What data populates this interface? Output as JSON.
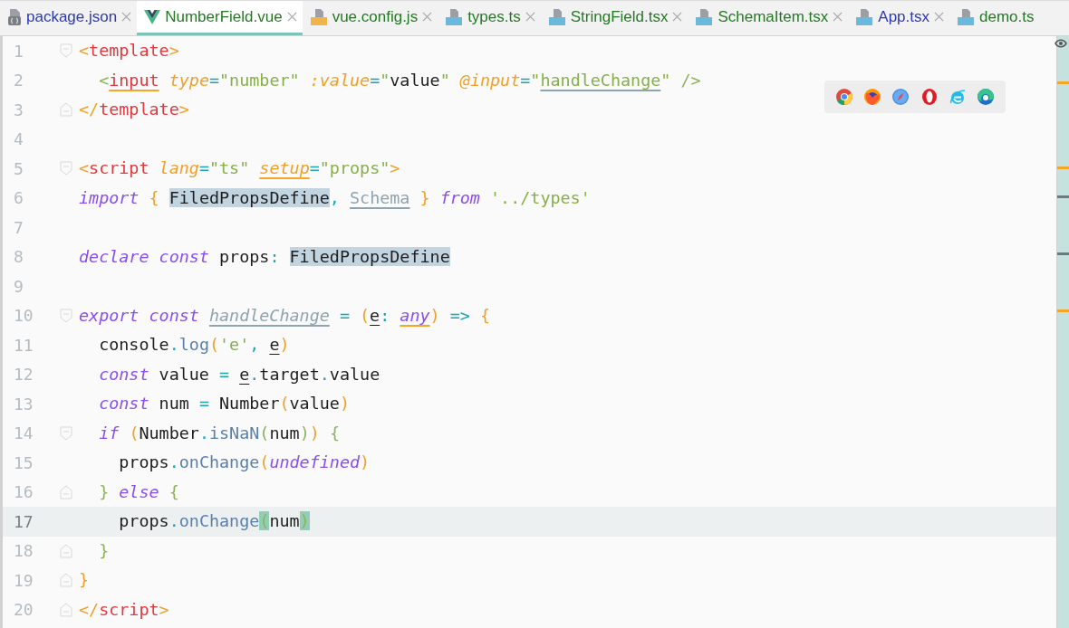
{
  "tabs": [
    {
      "label": "package.json",
      "kind": "json",
      "color": "#2b3ab0",
      "selected": false,
      "closable": true
    },
    {
      "label": "NumberField.vue",
      "kind": "vue",
      "color": "#247a24",
      "selected": true,
      "closable": true
    },
    {
      "label": "vue.config.js",
      "kind": "js",
      "color": "#247a24",
      "selected": false,
      "closable": true
    },
    {
      "label": "types.ts",
      "kind": "ts",
      "color": "#247a24",
      "selected": false,
      "closable": true
    },
    {
      "label": "StringField.tsx",
      "kind": "tsx",
      "color": "#247a24",
      "selected": false,
      "closable": true
    },
    {
      "label": "SchemaItem.tsx",
      "kind": "tsx",
      "color": "#247a24",
      "selected": false,
      "closable": true
    },
    {
      "label": "App.tsx",
      "kind": "tsx",
      "color": "#2b3ab0",
      "selected": false,
      "closable": true
    },
    {
      "label": "demo.ts",
      "kind": "ts",
      "color": "#247a24",
      "selected": false,
      "closable": false
    }
  ],
  "lines": [
    {
      "number": "1",
      "current": false,
      "kind": "fold-start",
      "tokens": [
        {
          "text": "<",
          "kind": "bracket"
        },
        {
          "text": "template",
          "kind": "tag"
        },
        {
          "text": ">",
          "kind": "bracket"
        }
      ]
    },
    {
      "number": "2",
      "current": false,
      "tokens": [
        {
          "text": "  <",
          "kind": "brace"
        },
        {
          "text": "input",
          "kind": "tag-warn"
        },
        {
          "text": " type",
          "kind": "attr"
        },
        {
          "text": "=",
          "kind": "op"
        },
        {
          "text": "\"number\"",
          "kind": "string"
        },
        {
          "text": " :value",
          "kind": "attr"
        },
        {
          "text": "=",
          "kind": "op"
        },
        {
          "text": "\"",
          "kind": "string"
        },
        {
          "text": "value",
          "kind": "plain"
        },
        {
          "text": "\"",
          "kind": "string"
        },
        {
          "text": " @input",
          "kind": "attr"
        },
        {
          "text": "=",
          "kind": "op"
        },
        {
          "text": "\"",
          "kind": "string"
        },
        {
          "text": "handleChange",
          "kind": "string-unused"
        },
        {
          "text": "\"",
          "kind": "string"
        },
        {
          "text": " />",
          "kind": "brace"
        }
      ]
    },
    {
      "number": "3",
      "current": false,
      "kind": "fold-end",
      "tokens": [
        {
          "text": "</",
          "kind": "bracket"
        },
        {
          "text": "template",
          "kind": "tag"
        },
        {
          "text": ">",
          "kind": "bracket"
        }
      ]
    },
    {
      "number": "4",
      "current": false
    },
    {
      "number": "5",
      "current": false,
      "kind": "fold-start",
      "tokens": [
        {
          "text": "<",
          "kind": "bracket"
        },
        {
          "text": "script",
          "kind": "tag"
        },
        {
          "text": " lang",
          "kind": "attr"
        },
        {
          "text": "=",
          "kind": "op"
        },
        {
          "text": "\"ts\" ",
          "kind": "string"
        },
        {
          "text": "setup",
          "kind": "attr-warn"
        },
        {
          "text": "=",
          "kind": "op"
        },
        {
          "text": "\"props\"",
          "kind": "string"
        },
        {
          "text": ">",
          "kind": "bracket"
        }
      ]
    },
    {
      "number": "6",
      "current": false,
      "tokens": [
        {
          "text": "import ",
          "kind": "keyword"
        },
        {
          "text": "{ ",
          "kind": "bracket"
        },
        {
          "text": "FiledPropsDefine",
          "kind": "highlight"
        },
        {
          "text": ", ",
          "kind": "op"
        },
        {
          "text": "Schema",
          "kind": "unused"
        },
        {
          "text": " } ",
          "kind": "bracket"
        },
        {
          "text": "from ",
          "kind": "keyword"
        },
        {
          "text": "'../types'",
          "kind": "string"
        }
      ]
    },
    {
      "number": "7",
      "current": false
    },
    {
      "number": "8",
      "current": false,
      "tokens": [
        {
          "text": "declare const ",
          "kind": "keyword"
        },
        {
          "text": "props",
          "kind": "plain"
        },
        {
          "text": ": ",
          "kind": "op"
        },
        {
          "text": "FiledPropsDefine",
          "kind": "highlight"
        }
      ]
    },
    {
      "number": "9",
      "current": false
    },
    {
      "number": "10",
      "current": false,
      "kind": "fold-start",
      "tokens": [
        {
          "text": "export const ",
          "kind": "keyword"
        },
        {
          "text": "handleChange",
          "kind": "unused-italic"
        },
        {
          "text": " = ",
          "kind": "op"
        },
        {
          "text": "(",
          "kind": "bracket"
        },
        {
          "text": "e",
          "kind": "param"
        },
        {
          "text": ": ",
          "kind": "op"
        },
        {
          "text": "any",
          "kind": "type-warn"
        },
        {
          "text": ")",
          "kind": "bracket"
        },
        {
          "text": " => ",
          "kind": "op"
        },
        {
          "text": "{",
          "kind": "bracket"
        }
      ]
    },
    {
      "number": "11",
      "current": false,
      "tokens": [
        {
          "text": "  console",
          "kind": "plain"
        },
        {
          "text": ".",
          "kind": "op"
        },
        {
          "text": "log",
          "kind": "method"
        },
        {
          "text": "(",
          "kind": "bracket"
        },
        {
          "text": "'e'",
          "kind": "string"
        },
        {
          "text": ", ",
          "kind": "op"
        },
        {
          "text": "e",
          "kind": "param"
        },
        {
          "text": ")",
          "kind": "bracket"
        }
      ]
    },
    {
      "number": "12",
      "current": false,
      "tokens": [
        {
          "text": "  const ",
          "kind": "keyword"
        },
        {
          "text": "value ",
          "kind": "plain"
        },
        {
          "text": "= ",
          "kind": "op"
        },
        {
          "text": "e",
          "kind": "param"
        },
        {
          "text": ".",
          "kind": "op"
        },
        {
          "text": "target",
          "kind": "plain"
        },
        {
          "text": ".",
          "kind": "op"
        },
        {
          "text": "value",
          "kind": "plain"
        }
      ]
    },
    {
      "number": "13",
      "current": false,
      "tokens": [
        {
          "text": "  const ",
          "kind": "keyword"
        },
        {
          "text": "num ",
          "kind": "plain"
        },
        {
          "text": "= ",
          "kind": "op"
        },
        {
          "text": "Number",
          "kind": "plain"
        },
        {
          "text": "(",
          "kind": "bracket"
        },
        {
          "text": "value",
          "kind": "plain"
        },
        {
          "text": ")",
          "kind": "bracket"
        }
      ]
    },
    {
      "number": "14",
      "current": false,
      "kind": "fold-start",
      "tokens": [
        {
          "text": "  if ",
          "kind": "keyword"
        },
        {
          "text": "(",
          "kind": "bracket"
        },
        {
          "text": "Number",
          "kind": "plain"
        },
        {
          "text": ".",
          "kind": "op"
        },
        {
          "text": "isNaN",
          "kind": "method"
        },
        {
          "text": "(",
          "kind": "brace"
        },
        {
          "text": "num",
          "kind": "plain"
        },
        {
          "text": ")",
          "kind": "brace"
        },
        {
          "text": ") ",
          "kind": "bracket"
        },
        {
          "text": "{",
          "kind": "brace"
        }
      ]
    },
    {
      "number": "15",
      "current": false,
      "tokens": [
        {
          "text": "    props",
          "kind": "plain"
        },
        {
          "text": ".",
          "kind": "op"
        },
        {
          "text": "onChange",
          "kind": "method"
        },
        {
          "text": "(",
          "kind": "bracket"
        },
        {
          "text": "undefined",
          "kind": "keyword"
        },
        {
          "text": ")",
          "kind": "bracket"
        }
      ]
    },
    {
      "number": "16",
      "current": false,
      "kind": "fold-end",
      "tokens": [
        {
          "text": "  } ",
          "kind": "brace"
        },
        {
          "text": "else ",
          "kind": "keyword"
        },
        {
          "text": "{",
          "kind": "brace"
        }
      ]
    },
    {
      "number": "17",
      "current": true,
      "tokens": [
        {
          "text": "    props",
          "kind": "plain"
        },
        {
          "text": ".",
          "kind": "op"
        },
        {
          "text": "onChange",
          "kind": "method"
        },
        {
          "text": "(",
          "kind": "match"
        },
        {
          "text": "num",
          "kind": "plain"
        },
        {
          "text": ")",
          "kind": "match"
        }
      ]
    },
    {
      "number": "18",
      "current": false,
      "kind": "fold-end",
      "tokens": [
        {
          "text": "  }",
          "kind": "brace"
        }
      ]
    },
    {
      "number": "19",
      "current": false,
      "kind": "fold-end",
      "tokens": [
        {
          "text": "}",
          "kind": "bracket"
        }
      ]
    },
    {
      "number": "20",
      "current": false,
      "kind": "fold-end",
      "tokens": [
        {
          "text": "</",
          "kind": "bracket"
        },
        {
          "text": "script",
          "kind": "tag"
        },
        {
          "text": ">",
          "kind": "bracket"
        }
      ]
    }
  ]
}
